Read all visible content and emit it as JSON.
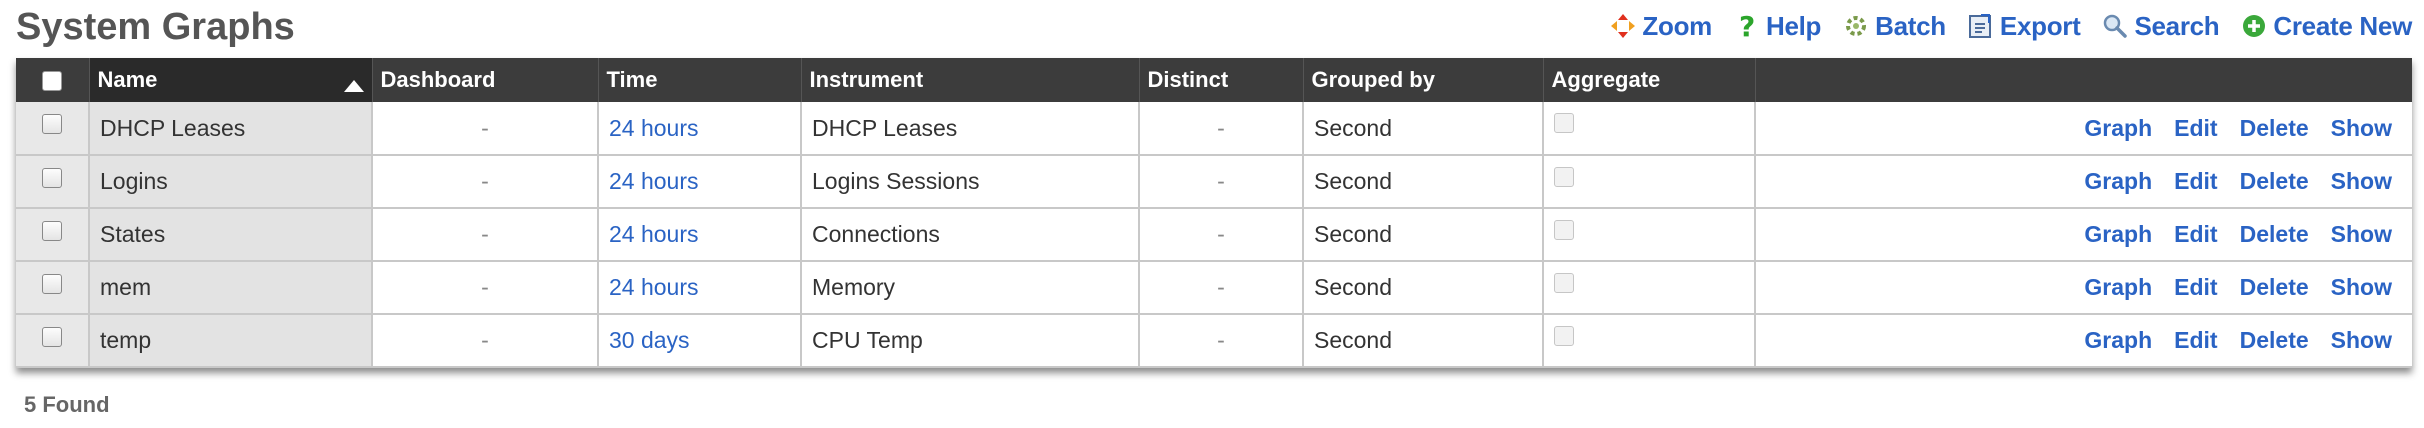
{
  "page_title": "System Graphs",
  "toolbar": [
    {
      "label": "Zoom",
      "icon": "zoom-icon"
    },
    {
      "label": "Help",
      "icon": "help-icon"
    },
    {
      "label": "Batch",
      "icon": "batch-icon"
    },
    {
      "label": "Export",
      "icon": "export-icon"
    },
    {
      "label": "Search",
      "icon": "search-icon"
    },
    {
      "label": "Create New",
      "icon": "create-new-icon"
    }
  ],
  "columns": {
    "name": "Name",
    "dashboard": "Dashboard",
    "time": "Time",
    "instrument": "Instrument",
    "distinct": "Distinct",
    "grouped_by": "Grouped by",
    "aggregate": "Aggregate"
  },
  "rows": [
    {
      "name": "DHCP Leases",
      "dashboard": "-",
      "time": "24 hours",
      "instrument": "DHCP Leases",
      "distinct": "-",
      "grouped_by": "Second"
    },
    {
      "name": "Logins",
      "dashboard": "-",
      "time": "24 hours",
      "instrument": "Logins Sessions",
      "distinct": "-",
      "grouped_by": "Second"
    },
    {
      "name": "States",
      "dashboard": "-",
      "time": "24 hours",
      "instrument": "Connections",
      "distinct": "-",
      "grouped_by": "Second"
    },
    {
      "name": "mem",
      "dashboard": "-",
      "time": "24 hours",
      "instrument": "Memory",
      "distinct": "-",
      "grouped_by": "Second"
    },
    {
      "name": "temp",
      "dashboard": "-",
      "time": "30 days",
      "instrument": "CPU Temp",
      "distinct": "-",
      "grouped_by": "Second"
    }
  ],
  "row_actions": {
    "graph": "Graph",
    "edit": "Edit",
    "delete": "Delete",
    "show": "Show"
  },
  "footer": {
    "found": "5 Found"
  },
  "colors": {
    "link": "#2a63c4",
    "header_bg": "#3c3c3c"
  }
}
